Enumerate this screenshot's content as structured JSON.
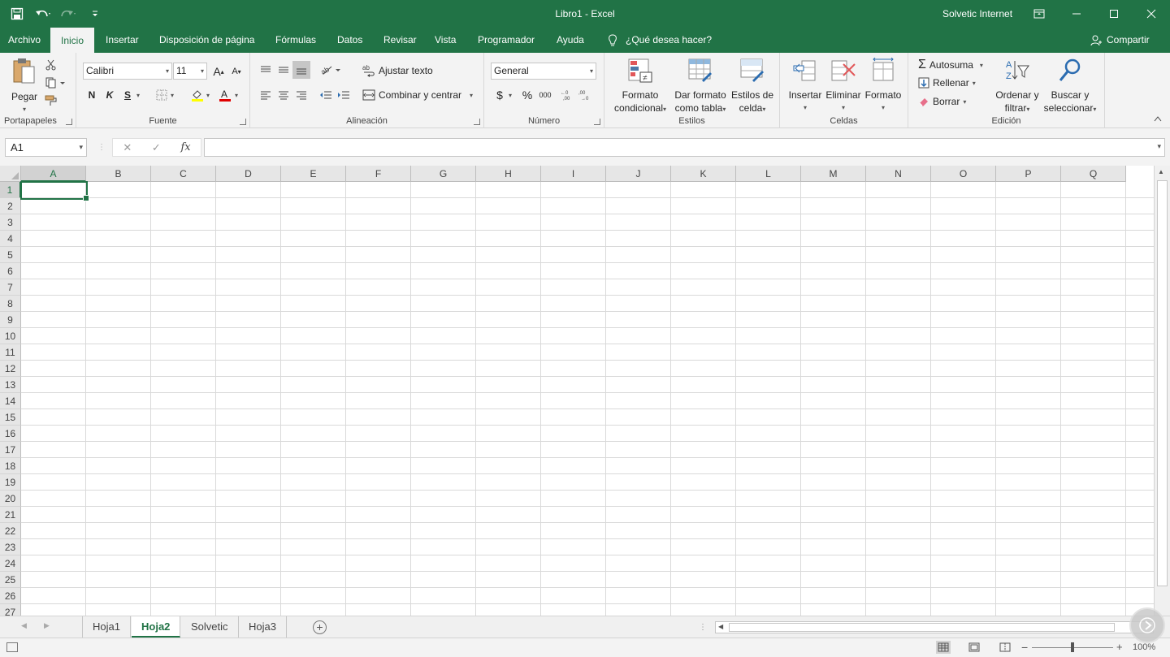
{
  "window": {
    "title": "Libro1  -  Excel",
    "user": "Solvetic Internet"
  },
  "tabs": [
    "Archivo",
    "Inicio",
    "Insertar",
    "Disposición de página",
    "Fórmulas",
    "Datos",
    "Revisar",
    "Vista",
    "Programador",
    "Ayuda"
  ],
  "active_tab": "Inicio",
  "tell_me": "¿Qué desea hacer?",
  "share": "Compartir",
  "ribbon": {
    "clipboard": {
      "paste": "Pegar",
      "label": "Portapapeles"
    },
    "font": {
      "name": "Calibri",
      "size": "11",
      "bold": "N",
      "italic": "K",
      "underline": "S",
      "label": "Fuente"
    },
    "alignment": {
      "wrap": "Ajustar texto",
      "merge": "Combinar y centrar",
      "label": "Alineación"
    },
    "number": {
      "format": "General",
      "currency": "$",
      "percent": "%",
      "thousands": "000",
      "label": "Número"
    },
    "styles": {
      "conditional_1": "Formato",
      "conditional_2": "condicional",
      "table_1": "Dar formato",
      "table_2": "como tabla",
      "cell_1": "Estilos de",
      "cell_2": "celda",
      "label": "Estilos"
    },
    "cells": {
      "insert": "Insertar",
      "delete": "Eliminar",
      "format": "Formato",
      "label": "Celdas"
    },
    "editing": {
      "autosum": "Autosuma",
      "fill": "Rellenar",
      "clear": "Borrar",
      "sort_1": "Ordenar y",
      "sort_2": "filtrar",
      "find_1": "Buscar y",
      "find_2": "seleccionar",
      "label": "Edición"
    }
  },
  "formula_bar": {
    "name_box": "A1",
    "fx": "fx",
    "value": ""
  },
  "grid": {
    "columns": [
      "A",
      "B",
      "C",
      "D",
      "E",
      "F",
      "G",
      "H",
      "I",
      "J",
      "K",
      "L",
      "M",
      "N",
      "O",
      "P",
      "Q"
    ],
    "rows": [
      "1",
      "2",
      "3",
      "4",
      "5",
      "6",
      "7",
      "8",
      "9",
      "10",
      "11",
      "12",
      "13",
      "14",
      "15",
      "16",
      "17",
      "18",
      "19",
      "20",
      "21",
      "22",
      "23",
      "24",
      "25",
      "26",
      "27"
    ],
    "active_cell": "A1"
  },
  "sheets": [
    "Hoja1",
    "Hoja2",
    "Solvetic",
    "Hoja3"
  ],
  "active_sheet": "Hoja2",
  "status": {
    "zoom": "100%"
  },
  "colors": {
    "accent": "#217346",
    "ribbon_bg": "#f3f3f3"
  }
}
